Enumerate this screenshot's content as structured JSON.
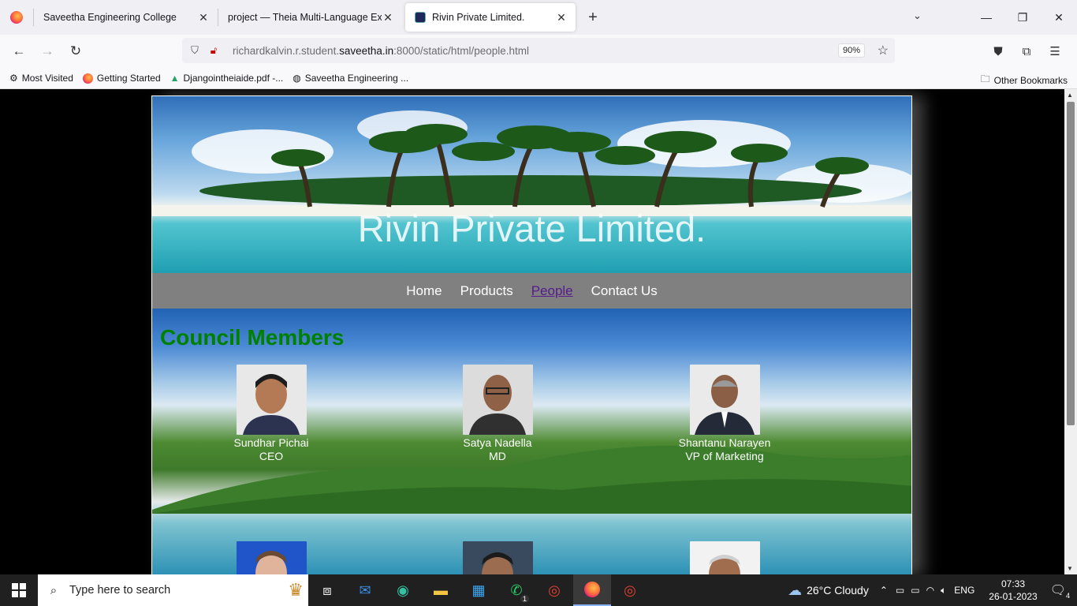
{
  "browser": {
    "tabs": [
      {
        "title": "Saveetha Engineering College"
      },
      {
        "title": "project — Theia Multi-Language Ex"
      },
      {
        "title": "Rivin Private Limited."
      }
    ],
    "url_prefix": "richardkalvin.r.student.",
    "url_domain": "saveetha.in",
    "url_suffix": ":8000/static/html/people.html",
    "zoom": "90%",
    "bookmarks": [
      {
        "label": "Most Visited",
        "icon": "gear-icon"
      },
      {
        "label": "Getting Started",
        "icon": "firefox-icon"
      },
      {
        "label": "Djangointheiaide.pdf -...",
        "icon": "google-drive-icon"
      },
      {
        "label": "Saveetha Engineering ...",
        "icon": "globe-icon"
      }
    ],
    "other_bookmarks": "Other Bookmarks"
  },
  "site": {
    "title": "Rivin Private Limited.",
    "menu": [
      "Home",
      "Products",
      "People",
      "Contact Us"
    ],
    "section_title": "Council Members",
    "members": [
      {
        "name": "Sundhar Pichai",
        "role": "CEO"
      },
      {
        "name": "Satya Nadella",
        "role": "MD"
      },
      {
        "name": "Shantanu Narayen",
        "role": "VP of Marketing"
      }
    ]
  },
  "taskbar": {
    "search_placeholder": "Type here to search",
    "weather": "26°C  Cloudy",
    "language": "ENG",
    "time": "07:33",
    "date": "26-01-2023",
    "whatsapp_badge": "1",
    "notification_count": "4"
  },
  "colors": {
    "section_title": "#008000",
    "menu_bg": "#808080",
    "active_link": "#551a8b"
  }
}
